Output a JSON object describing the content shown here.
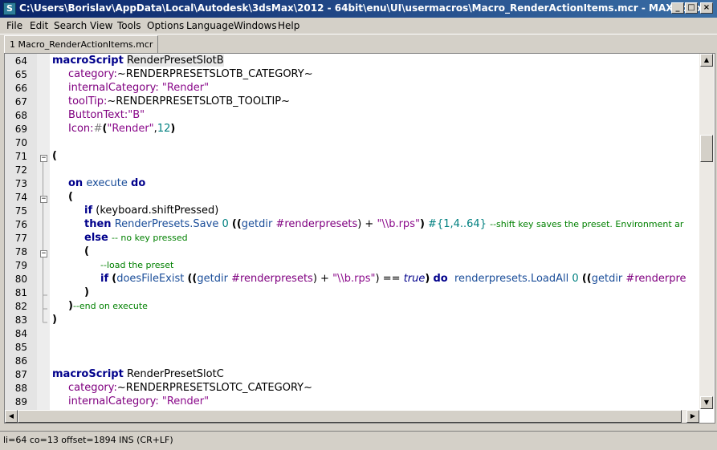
{
  "window": {
    "title": "C:\\Users\\Borislav\\AppData\\Local\\Autodesk\\3dsMax\\2012 - 64bit\\enu\\UI\\usermacros\\Macro_RenderActionItems.mcr - MAXScript",
    "icon": "maxscript-app-icon"
  },
  "menu": [
    "File",
    "Edit",
    "Search",
    "View",
    "Tools",
    "Options",
    "Language",
    "Windows",
    "Help"
  ],
  "tab": {
    "label": "1 Macro_RenderActionItems.mcr"
  },
  "editor": {
    "line_numbers": [
      "64",
      "65",
      "66",
      "67",
      "68",
      "69",
      "70",
      "71",
      "72",
      "73",
      "74",
      "75",
      "76",
      "77",
      "78",
      "79",
      "80",
      "81",
      "82",
      "83",
      "84",
      "85",
      "86",
      "87",
      "88",
      "89"
    ],
    "code": {
      "l64_kw": "macroScript",
      "l64_name": "RenderPresetSlotB",
      "l65_key": "category:",
      "l65_val": "~RENDERPRESETSLOTB_CATEGORY~",
      "l66_key": "internalCategory:",
      "l66_val": "\"Render\"",
      "l67_key": "toolTip:",
      "l67_val": "~RENDERPRESETSLOTB_TOOLTIP~",
      "l68_key": "ButtonText:",
      "l68_val": "\"B\"",
      "l69_key": "Icon:",
      "l69_hash": "#",
      "l69_paren": "(",
      "l69_str": "\"Render\"",
      "l69_comma": ",",
      "l69_num": "12",
      "l69_close": ")",
      "l71": "(",
      "l73_on": "on",
      "l73_exec": "execute",
      "l73_do": "do",
      "l74": "(",
      "l75_if": "if",
      "l75_rest": "(keyboard.shiftPressed)",
      "l76_then": "then",
      "l76_call": "RenderPresets.Save",
      "l76_zero": "0",
      "l76_pp": "((",
      "l76_getdir": "getdir",
      "l76_rp": "#renderpresets",
      "l76_plus": ") +",
      "l76_str": "\"\\\\b.rps\"",
      "l76_close": ")",
      "l76_set": "#{1,4..64}",
      "l76_cm": "--shift key saves the preset. Environment ar",
      "l77_else": "else",
      "l77_cm": "-- no key pressed",
      "l78": "(",
      "l79_cm": "--load the preset",
      "l80_if": "if",
      "l80_open": "(",
      "l80_fn": "doesFileExist",
      "l80_pp": "((",
      "l80_getdir": "getdir",
      "l80_rp": "#renderpresets",
      "l80_plus": ") +",
      "l80_str": "\"\\\\b.rps\"",
      "l80_eq": ") ==",
      "l80_true": "true",
      "l80_close": ")",
      "l80_do": "do",
      "l80_load": "renderpresets.LoadAll",
      "l80_zero": "0",
      "l80_pp2": "((",
      "l80_getdir2": "getdir",
      "l80_rp2": "#renderpre",
      "l81": ")",
      "l82_paren": ")",
      "l82_cm": "--end on execute",
      "l83": ")",
      "l87_kw": "macroScript",
      "l87_name": "RenderPresetSlotC",
      "l88_key": "category:",
      "l88_val": "~RENDERPRESETSLOTC_CATEGORY~",
      "l89_key": "internalCategory:",
      "l89_val": "\"Render\""
    }
  },
  "statusbar": {
    "text": "li=64 co=13 offset=1894 INS (CR+LF)"
  }
}
